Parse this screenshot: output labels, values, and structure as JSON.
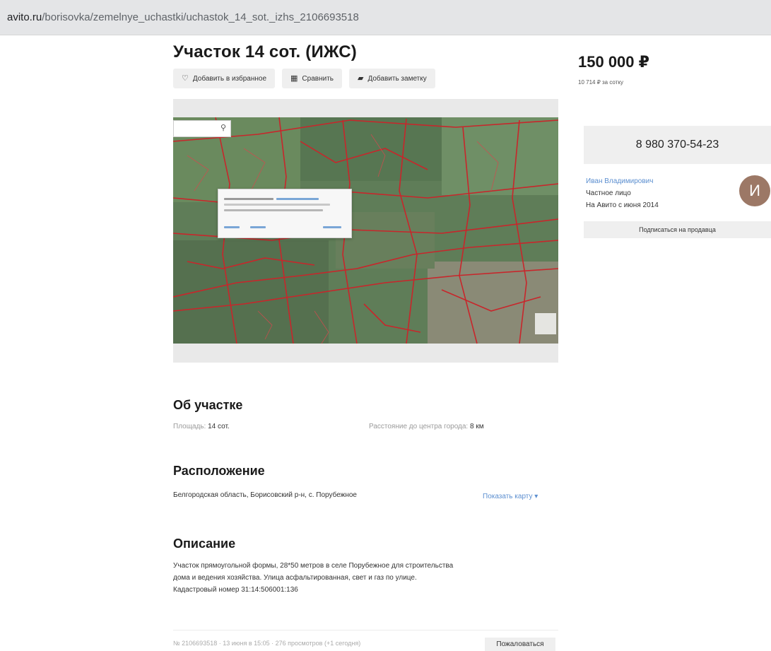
{
  "browser": {
    "url_host": "avito.ru",
    "url_path": "/borisovka/zemelnye_uchastki/uchastok_14_sot._izhs_2106693518"
  },
  "listing": {
    "title": "Участок 14 сот. (ИЖС)",
    "actions": {
      "favorite": "Добавить в избранное",
      "compare": "Сравнить",
      "note": "Добавить заметку"
    }
  },
  "about": {
    "heading": "Об участке",
    "area_label": "Площадь:",
    "area_value": "14 сот.",
    "distance_label": "Расстояние до центра города:",
    "distance_value": "8 км"
  },
  "location": {
    "heading": "Расположение",
    "address": "Белгородская область, Борисовский р-н, с. Порубежное",
    "show_map": "Показать карту"
  },
  "description": {
    "heading": "Описание",
    "line1": "Участок прямоугольной формы, 28*50 метров в селе Порубежное для строительства",
    "line2": "дома и ведения хозяйства. Улица асфальтированная, свет и газ по улице.",
    "line3": "Кадастровый номер 31:14:506001:136"
  },
  "footer": {
    "ad_id": "№ 2106693518",
    "date": "13 июня в 15:05",
    "views": "276 просмотров (+1 сегодня)",
    "complain": "Пожаловаться"
  },
  "sidebar": {
    "price": "150 000 ₽",
    "price_per": "10 714 ₽ за сотку",
    "phone": "8 980 370-54-23",
    "seller_name": "Иван Владимирович",
    "seller_type": "Частное лицо",
    "seller_since": "На Авито с июня 2014",
    "avatar_letter": "И",
    "subscribe": "Подписаться на продавца"
  },
  "colors": {
    "link": "#5c8fd0",
    "avatar": "#9c7866",
    "map_parcel_lines": "#c8262b"
  },
  "icons": {
    "favorite": "heart-icon",
    "compare": "compare-icon",
    "note": "note-icon",
    "show_map": "chevron-down-icon",
    "map_search": "search-icon"
  }
}
